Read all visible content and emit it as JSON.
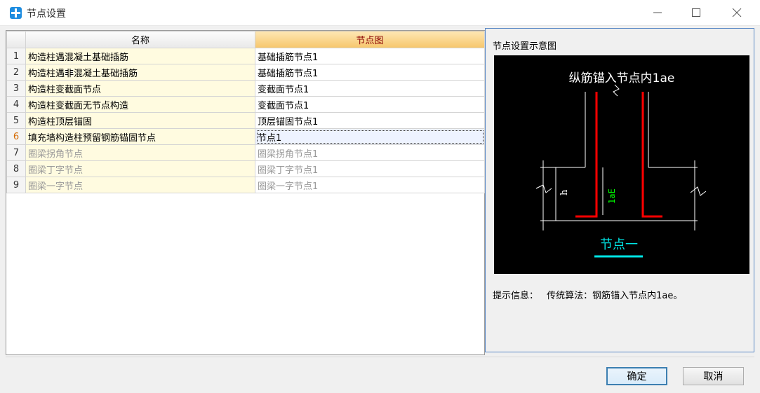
{
  "window": {
    "title": "节点设置"
  },
  "table": {
    "columns": [
      "名称",
      "节点图"
    ],
    "rows": [
      {
        "num": "1",
        "name": "构造柱遇混凝土基础插筋",
        "node": "基础插筋节点1",
        "enabled": true
      },
      {
        "num": "2",
        "name": "构造柱遇非混凝土基础插筋",
        "node": "基础插筋节点1",
        "enabled": true
      },
      {
        "num": "3",
        "name": "构造柱变截面节点",
        "node": "变截面节点1",
        "enabled": true
      },
      {
        "num": "4",
        "name": "构造柱变截面无节点构造",
        "node": "变截面节点1",
        "enabled": true
      },
      {
        "num": "5",
        "name": "构造柱顶层锚固",
        "node": "顶层锚固节点1",
        "enabled": true
      },
      {
        "num": "6",
        "name": "填充墙构造柱预留钢筋锚固节点",
        "node": "节点1",
        "enabled": true,
        "selected": true
      },
      {
        "num": "7",
        "name": "圈梁拐角节点",
        "node": "圈梁拐角节点1",
        "enabled": false
      },
      {
        "num": "8",
        "name": "圈梁丁字节点",
        "node": "圈梁丁字节点1",
        "enabled": false
      },
      {
        "num": "9",
        "name": "圈梁一字节点",
        "node": "圈梁一字节点1",
        "enabled": false
      }
    ]
  },
  "preview": {
    "title": "节点设置示意图",
    "diagram_heading": "纵筋锚入节点内1ae",
    "dim_h": "h",
    "dim_lae": "1aE",
    "diagram_caption": "节点一",
    "hint_label": "提示信息：",
    "hint_text": "传统算法：钢筋锚入节点内1ae。"
  },
  "buttons": {
    "ok": "确定",
    "cancel": "取消"
  },
  "colors": {
    "rebar": "#ff0000",
    "dim_line": "#ffffff",
    "lae_label": "#00ff00",
    "caption": "#00e5e5",
    "active_header": "#f6c66c"
  }
}
